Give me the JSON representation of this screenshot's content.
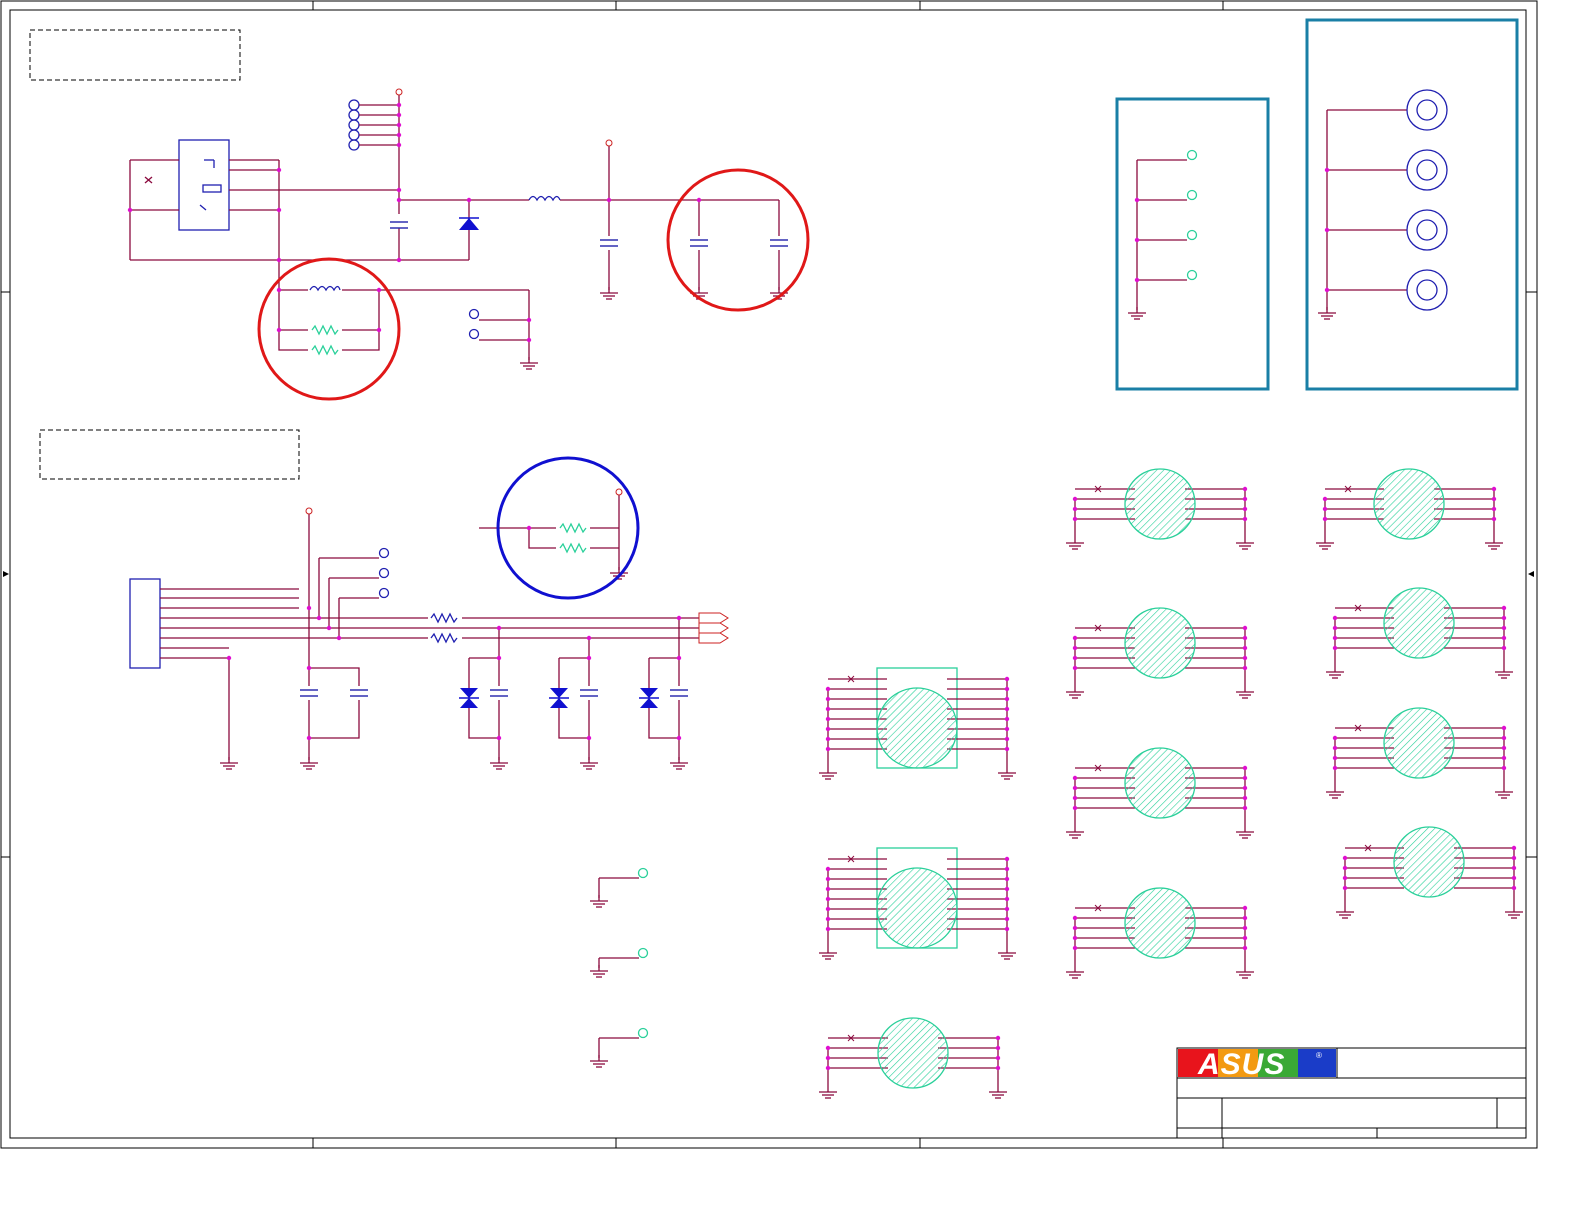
{
  "title_block": {
    "logo_text": "ASUS",
    "registered_mark": "®"
  },
  "colors": {
    "wire": "#8b0a3e",
    "junction": "#e010d0",
    "component_outline": "#2020b0",
    "pad_footprint": "#2ad09a",
    "highlight_red": "#e01818",
    "highlight_blue": "#1010d0",
    "highlight_box": "#1a7fa6"
  },
  "icons": {
    "ground": "ground-symbol-icon",
    "capacitor": "capacitor-icon",
    "inductor": "inductor-icon",
    "resistor": "resistor-icon",
    "diode": "diode-icon",
    "tvs_diode": "tvs-diode-icon",
    "test_point": "test-point-icon",
    "mounting_hole": "mounting-hole-icon",
    "power_jack": "dc-power-jack-icon",
    "connector": "connector-icon"
  }
}
